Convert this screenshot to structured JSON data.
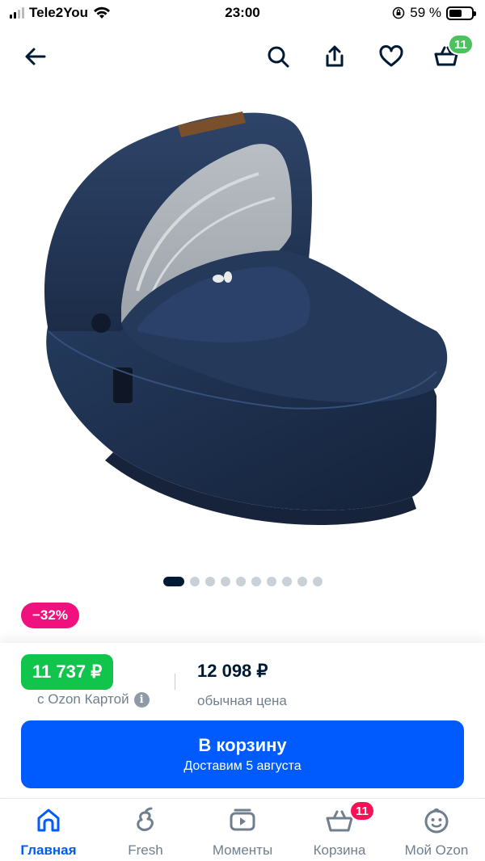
{
  "status_bar": {
    "carrier": "Tele2You",
    "time": "23:00",
    "battery_percent": "59 %",
    "battery_level": 0.59
  },
  "topnav": {
    "icons": [
      "arrow-left-icon",
      "search-icon",
      "share-icon",
      "heart-icon",
      "basket-icon"
    ],
    "cart_count": "11"
  },
  "gallery": {
    "total_images": 10,
    "active_index": 0
  },
  "product": {
    "discount": "−32%",
    "ozon_card_price": "11 737 ₽",
    "ozon_card_label": "с Ozon Картой",
    "regular_price": "12 098 ₽",
    "regular_label": "обычная цена"
  },
  "cart_button": {
    "label": "В корзину",
    "delivery": "Доставим 5 августа"
  },
  "tabbar": {
    "items": [
      {
        "label": "Главная",
        "icon": "home-icon",
        "active": true
      },
      {
        "label": "Fresh",
        "icon": "fresh-icon",
        "active": false
      },
      {
        "label": "Моменты",
        "icon": "play-icon",
        "active": false
      },
      {
        "label": "Корзина",
        "icon": "basket-icon",
        "active": false,
        "badge": "11"
      },
      {
        "label": "Мой Ozon",
        "icon": "smiley-icon",
        "active": false
      }
    ]
  },
  "colors": {
    "accent_blue": "#005bff",
    "ozon_green": "#10c44c",
    "discount_pink": "#f1117e",
    "badge_red": "#f91155",
    "text_dark": "#001a34"
  }
}
